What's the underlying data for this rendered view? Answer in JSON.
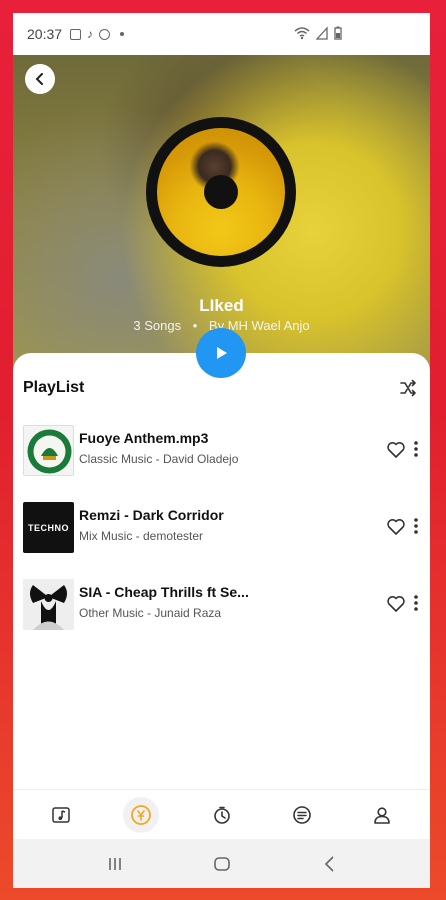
{
  "status_bar": {
    "time": "20:37"
  },
  "header": {
    "back_icon": "chevron-left-icon"
  },
  "playlist_info": {
    "title": "LIked",
    "songs_count": "3 Songs",
    "separator": "•",
    "author": "By MH Wael Anjo"
  },
  "playlist": {
    "heading": "PlayList",
    "shuffle_icon": "shuffle-icon",
    "tracks": [
      {
        "title": "Fuoye Anthem.mp3",
        "subtitle": "Classic Music - David Oladejo",
        "thumb": "seal"
      },
      {
        "title": "Remzi - Dark Corridor",
        "subtitle": "Mix Music - demotester",
        "thumb_label": "TECHNO",
        "thumb": "techno"
      },
      {
        "title": "SIA - Cheap Thrills ft Se...",
        "subtitle": "Other Music - Junaid Raza",
        "thumb": "bow"
      }
    ]
  },
  "bottom_nav": {
    "items": [
      "music-note-icon",
      "coin-icon",
      "timer-icon",
      "playlist-icon",
      "profile-icon"
    ],
    "active_index": 1
  },
  "colors": {
    "accent": "#2196f3",
    "frame_red": "#e11f2f",
    "coin_orange": "#f5a623"
  }
}
